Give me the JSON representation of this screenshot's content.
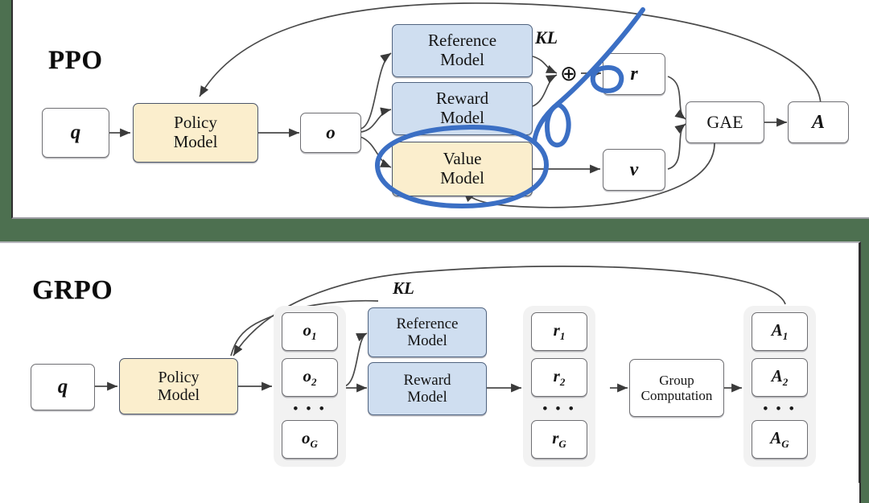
{
  "figure": {
    "background_color": "#4d7050",
    "panel_color": "#ffffff",
    "annotation_color": "#3b6fc4",
    "box_yellow": "#fbeecd",
    "box_blue": "#cfdef0",
    "group_gray": "#f2f2f2",
    "top_cut_text": ""
  },
  "ppo": {
    "title": "PPO",
    "nodes": {
      "query": "q",
      "policy_model_line1": "Policy",
      "policy_model_line2": "Model",
      "output": "o",
      "reference_model_line1": "Reference",
      "reference_model_line2": "Model",
      "reward_model_line1": "Reward",
      "reward_model_line2": "Model",
      "value_model_line1": "Value",
      "value_model_line2": "Model",
      "reward": "r",
      "value": "v",
      "gae": "GAE",
      "advantage": "A"
    },
    "labels": {
      "kl": "KL",
      "plus": "⊕"
    }
  },
  "grpo": {
    "title": "GRPO",
    "nodes": {
      "query": "q",
      "policy_model_line1": "Policy",
      "policy_model_line2": "Model",
      "reference_model_line1": "Reference",
      "reference_model_line2": "Model",
      "reward_model_line1": "Reward",
      "reward_model_line2": "Model",
      "group_computation_line1": "Group",
      "group_computation_line2": "Computation"
    },
    "labels": {
      "kl": "KL",
      "ellipsis": "• • •"
    },
    "outputs": {
      "o1": "o",
      "o1_sub": "1",
      "o2": "o",
      "o2_sub": "2",
      "oG": "o",
      "oG_sub": "G"
    },
    "rewards": {
      "r1": "r",
      "r1_sub": "1",
      "r2": "r",
      "r2_sub": "2",
      "rG": "r",
      "rG_sub": "G"
    },
    "advantages": {
      "A1": "A",
      "A1_sub": "1",
      "A2": "A",
      "A2_sub": "2",
      "AG": "A",
      "AG_sub": "G"
    }
  },
  "annotations": {
    "value_model_circle": "hand-drawn blue ellipse around Value Model",
    "reward_loop": "hand-drawn blue loop over r box",
    "vertical_loop": "hand-drawn blue vertical loop",
    "diagonal_stroke": "hand-drawn blue diagonal stroke"
  }
}
